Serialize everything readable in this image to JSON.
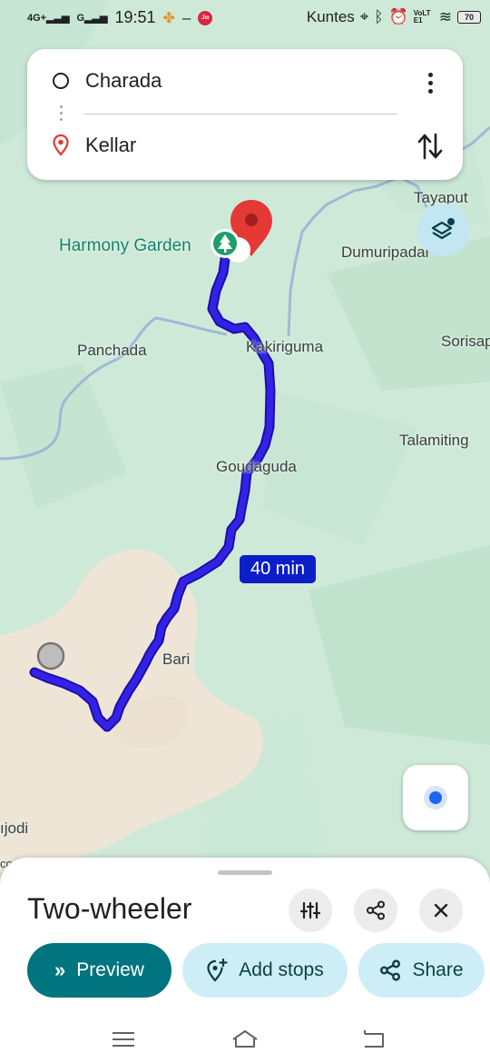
{
  "status_bar": {
    "network_1": "4G+",
    "network_2": "G",
    "time": "19:51",
    "carrier_badge": "Jio",
    "network_name": "Kuntes",
    "volte": "VoLTE1",
    "battery": "70"
  },
  "route": {
    "origin": "Charada",
    "destination": "Kellar"
  },
  "map": {
    "labels": {
      "harmony_garden": "Harmony Garden",
      "tayaput": "Tayaput",
      "dumuripadar": "Dumuripadar",
      "sorisap": "Sorisap",
      "panchada": "Panchada",
      "kakiriguma": "Kakiriguma",
      "talamiting": "Talamiting",
      "goudaguda": "Goudaguda",
      "bari": "Bari",
      "jodi": "ıjodi",
      "co": "co"
    },
    "duration": "40 min",
    "route_color": "#2e1fd6",
    "route_outline": "#1a0fa8"
  },
  "sheet": {
    "mode": "Two-wheeler",
    "preview_label": "Preview",
    "add_stops_label": "Add stops",
    "share_label": "Share"
  },
  "icons": {
    "options": "tune-icon",
    "share": "share-icon",
    "close": "close-icon",
    "layers": "layers-icon",
    "swap": "swap-vert-icon",
    "location": "my-location-icon",
    "destination_pin": "place-icon",
    "park": "park-icon"
  },
  "colors": {
    "accent": "#00747f",
    "pill_bg": "#cdeef6",
    "pin_red": "#e53935",
    "park_green": "#1e9e6a",
    "map_bg": "#cfe9d8"
  }
}
